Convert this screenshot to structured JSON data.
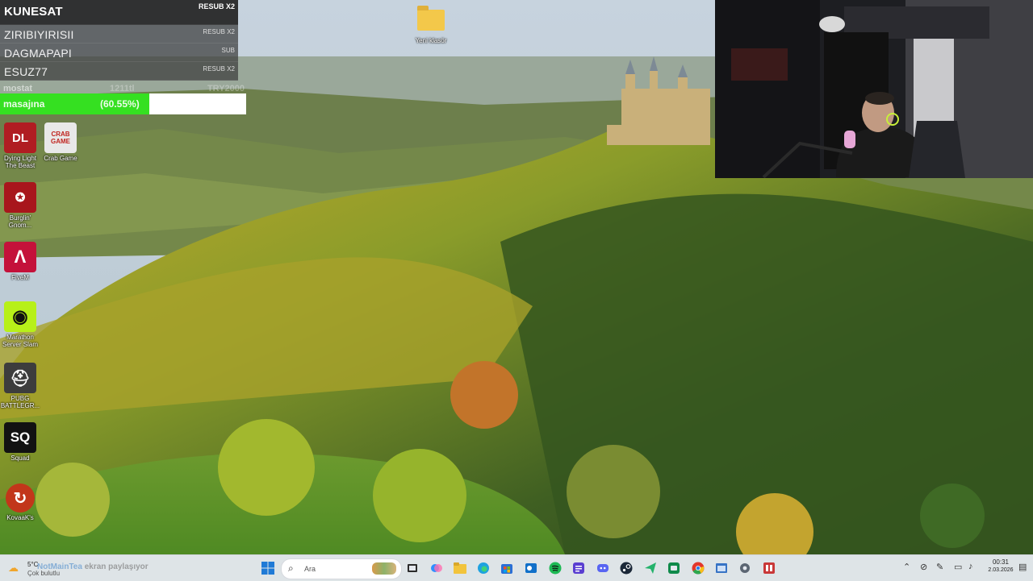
{
  "alerts": [
    {
      "name": "KUNESAT",
      "badge": "RESUB X2"
    },
    {
      "name": "ZIRIBIYIRISII",
      "badge": "RESUB X2"
    },
    {
      "name": "DAGMAPAPI",
      "badge": "SUB"
    },
    {
      "name": "ESUZ77",
      "badge": "RESUB X2"
    }
  ],
  "goal": {
    "top_label": "mostat",
    "stat_left": "1211tl",
    "stat_right": "TRY2000",
    "name": "masajına",
    "percent_text": "(60.55%)",
    "progress": 0.6055,
    "fill_color": "#35e021"
  },
  "desktop": {
    "folder_label": "Yeni klasör",
    "icons": [
      {
        "label": "Dying Light The Beast",
        "glyph": "DL",
        "bg": "#b01d22",
        "icon": "dying-light-icon"
      },
      {
        "label": "Crab Game",
        "glyph": "CRAB GAME",
        "bg": "#e8e8e8",
        "icon": "crab-game-icon"
      },
      {
        "label": "Burglin' Gnom...",
        "glyph": "✪",
        "bg": "#a8161c",
        "icon": "burglin-gnomes-icon"
      },
      {
        "label": "FiveM",
        "glyph": "Λ",
        "bg": "#c4113a",
        "icon": "fivem-icon"
      },
      {
        "label": "Marathon Server Slam",
        "glyph": "◉",
        "bg": "#b7f019",
        "icon": "marathon-icon"
      },
      {
        "label": "PUBG BATTLEGR...",
        "glyph": "⛑",
        "bg": "#3d3d3d",
        "icon": "pubg-icon"
      },
      {
        "label": "Squad",
        "glyph": "SQ",
        "bg": "#121212",
        "icon": "squad-icon"
      },
      {
        "label": "KovaaK's",
        "glyph": "↻",
        "bg": "#c2361a",
        "icon": "kovaaks-icon"
      }
    ]
  },
  "taskbar": {
    "weather_temp": "5°C",
    "weather_desc": "Çok bulutlu",
    "share_user": "NotMainTea",
    "share_text": "ekran paylaşıyor",
    "search_placeholder": "Ara",
    "time": "00:31",
    "date": "2.03.2026"
  },
  "colors": {
    "taskbar_bg": "#e4e8ee",
    "goal_track": "#ffffff"
  }
}
